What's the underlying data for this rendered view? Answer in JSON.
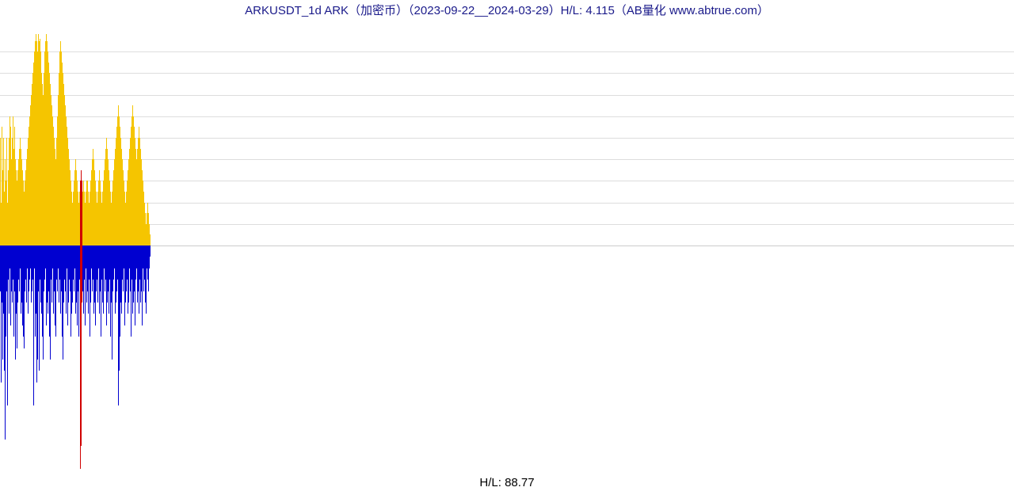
{
  "title": "ARKUSDT_1d ARK（加密币）（2023-09-22__2024-03-29）H/L: 4.115（AB量化  www.abtrue.com）",
  "footer": "H/L: 88.77",
  "chart_data": {
    "type": "bar",
    "title": "ARKUSDT_1d ARK（加密币）（2023-09-22__2024-03-29）H/L: 4.115",
    "xlabel": "",
    "ylabel": "",
    "baseline": 0,
    "grid_y": [
      0,
      1,
      2,
      3,
      4,
      5,
      6,
      7,
      8,
      9
    ],
    "ylim_up": [
      0,
      10
    ],
    "ylim_down": [
      0,
      -100
    ],
    "mark_indices": [
      101,
      102,
      103
    ],
    "up": [
      5.0,
      2.0,
      5.5,
      3.5,
      5.0,
      2.5,
      4.0,
      3.0,
      5.0,
      2.0,
      3.5,
      5.0,
      6.0,
      5.5,
      4.0,
      5.0,
      6.0,
      4.5,
      5.5,
      4.0,
      3.5,
      3.0,
      3.5,
      4.0,
      4.5,
      5.0,
      4.5,
      4.0,
      3.5,
      3.0,
      2.5,
      3.0,
      3.5,
      4.0,
      4.5,
      5.0,
      5.5,
      6.0,
      6.5,
      7.0,
      7.5,
      8.0,
      8.5,
      9.0,
      9.5,
      9.8,
      9.5,
      9.0,
      9.8,
      9.5,
      9.6,
      9.0,
      8.0,
      7.5,
      7.0,
      8.0,
      9.0,
      9.5,
      9.8,
      9.5,
      9.0,
      8.5,
      8.0,
      7.5,
      7.0,
      6.5,
      6.0,
      5.5,
      5.0,
      4.5,
      4.0,
      5.0,
      6.0,
      7.0,
      8.0,
      9.0,
      9.5,
      9.0,
      8.5,
      8.0,
      7.5,
      7.0,
      6.5,
      6.0,
      5.5,
      5.0,
      4.5,
      4.0,
      3.5,
      3.0,
      2.5,
      2.0,
      2.5,
      3.0,
      3.5,
      4.0,
      3.5,
      3.0,
      2.5,
      2.0,
      2.5,
      3.0,
      3.5,
      3.0,
      2.5,
      3.0,
      2.5,
      2.0,
      2.5,
      3.0,
      3.0,
      2.5,
      2.0,
      2.5,
      3.0,
      3.5,
      4.0,
      4.5,
      4.0,
      3.5,
      3.0,
      2.5,
      2.0,
      2.5,
      3.0,
      3.5,
      3.0,
      2.5,
      2.0,
      2.5,
      3.0,
      3.5,
      4.0,
      4.5,
      5.0,
      4.5,
      4.0,
      3.5,
      3.0,
      2.5,
      2.0,
      2.5,
      3.0,
      3.5,
      4.0,
      4.5,
      5.0,
      5.5,
      6.0,
      6.5,
      6.0,
      5.5,
      5.0,
      4.5,
      4.0,
      3.5,
      3.0,
      2.5,
      2.0,
      2.5,
      3.0,
      3.5,
      4.0,
      4.5,
      5.0,
      5.5,
      6.0,
      6.5,
      6.0,
      5.5,
      5.0,
      4.5,
      4.0,
      4.5,
      5.0,
      5.5,
      5.0,
      4.5,
      4.0,
      3.5,
      3.0,
      2.5,
      2.0,
      1.5,
      1.0,
      1.5,
      2.0,
      1.5,
      1.0,
      0.5
    ],
    "down": [
      -20,
      -60,
      -25,
      -50,
      -30,
      -55,
      -85,
      -40,
      -20,
      -70,
      -15,
      -30,
      -10,
      -35,
      -20,
      -25,
      -15,
      -40,
      -20,
      -50,
      -30,
      -45,
      -25,
      -15,
      -20,
      -10,
      -30,
      -25,
      -35,
      -40,
      -45,
      -20,
      -15,
      -25,
      -10,
      -30,
      -20,
      -15,
      -10,
      -25,
      -20,
      -15,
      -70,
      -10,
      -40,
      -30,
      -60,
      -50,
      -20,
      -55,
      -15,
      -25,
      -30,
      -40,
      -50,
      -20,
      -15,
      -10,
      -35,
      -25,
      -30,
      -20,
      -40,
      -50,
      -15,
      -25,
      -10,
      -30,
      -20,
      -35,
      -40,
      -15,
      -20,
      -10,
      -25,
      -15,
      -30,
      -20,
      -40,
      -50,
      -25,
      -15,
      -20,
      -30,
      -10,
      -35,
      -25,
      -15,
      -20,
      -40,
      -30,
      -25,
      -15,
      -20,
      -10,
      -30,
      -25,
      -35,
      -20,
      -40,
      -15,
      -98,
      -88,
      -25,
      -20,
      -30,
      -15,
      -35,
      -10,
      -25,
      -20,
      -30,
      -15,
      -40,
      -25,
      -10,
      -20,
      -15,
      -30,
      -25,
      -35,
      -20,
      -15,
      -25,
      -10,
      -30,
      -20,
      -40,
      -15,
      -25,
      -30,
      -10,
      -20,
      -15,
      -35,
      -25,
      -20,
      -30,
      -15,
      -40,
      -25,
      -50,
      -20,
      -15,
      -10,
      -30,
      -25,
      -20,
      -15,
      -70,
      -55,
      -40,
      -25,
      -30,
      -15,
      -20,
      -10,
      -35,
      -25,
      -20,
      -15,
      -30,
      -25,
      -10,
      -20,
      -40,
      -15,
      -30,
      -25,
      -20,
      -35,
      -15,
      -10,
      -25,
      -20,
      -30,
      -15,
      -25,
      -20,
      -35,
      -10,
      -20,
      -15,
      -25,
      -30,
      -10,
      -15,
      -20,
      -10,
      -5
    ]
  }
}
